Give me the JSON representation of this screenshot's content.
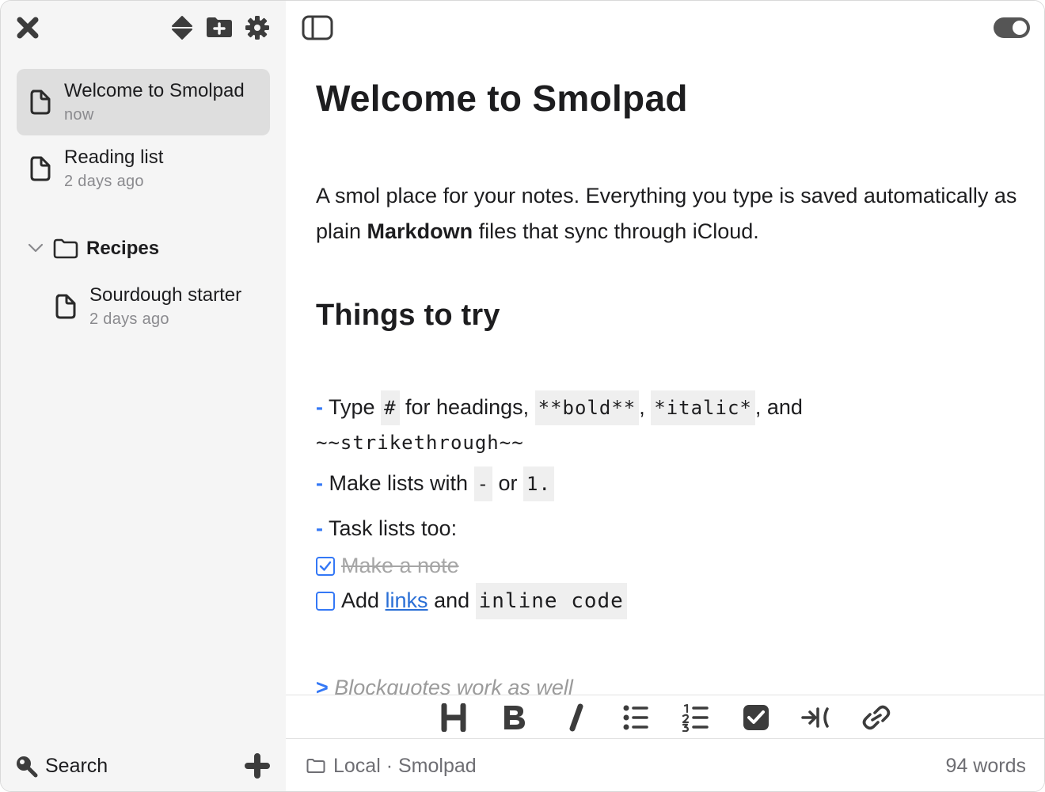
{
  "sidebar": {
    "notes": [
      {
        "title": "Welcome to Smolpad",
        "subtitle": "now",
        "active": true
      },
      {
        "title": "Reading list",
        "subtitle": "2 days ago",
        "active": false
      }
    ],
    "folder": {
      "name": "Recipes",
      "expanded": true,
      "notes": [
        {
          "title": "Sourdough starter",
          "subtitle": "2 days ago"
        }
      ]
    },
    "search_label": "Search"
  },
  "editor": {
    "title": "Welcome to Smolpad",
    "intro_before": "A smol place for your notes. Everything you type is saved automatically as plain ",
    "intro_bold": "Markdown",
    "intro_after": " files that sync through iCloud.",
    "heading": "Things to try",
    "list_marker": "-",
    "item1": {
      "text_a": "Type ",
      "code_a": "#",
      "text_b": " for headings, ",
      "code_b": "**bold**",
      "text_c": ", ",
      "code_c": "*italic*",
      "text_d": ", and",
      "code_d": "~~strikethrough~~"
    },
    "item2": {
      "text_a": "Make lists with ",
      "code_a": "-",
      "text_b": " or ",
      "code_b": "1."
    },
    "item3": {
      "text": "Task lists too:"
    },
    "task1": {
      "text": "Make a note",
      "checked": true
    },
    "task2": {
      "text_a": "Add ",
      "link": "links",
      "text_b": " and ",
      "code": "inline code",
      "checked": false
    },
    "quote_marker": ">",
    "quote_text": "Blockquotes work as well"
  },
  "toolbar": {
    "buttons": [
      "heading-icon",
      "bold-icon",
      "italic-icon",
      "bullet-list-icon",
      "numbered-list-icon",
      "checkbox-icon",
      "indent-icon",
      "link-icon"
    ]
  },
  "status": {
    "location": "Local · Smolpad",
    "word_count": "94 words"
  },
  "colors": {
    "accent": "#3478f6",
    "link": "#2a6fd6",
    "sidebar_bg": "#f5f5f5",
    "selected_bg": "#dedede",
    "muted_text": "#8a8a8e"
  }
}
